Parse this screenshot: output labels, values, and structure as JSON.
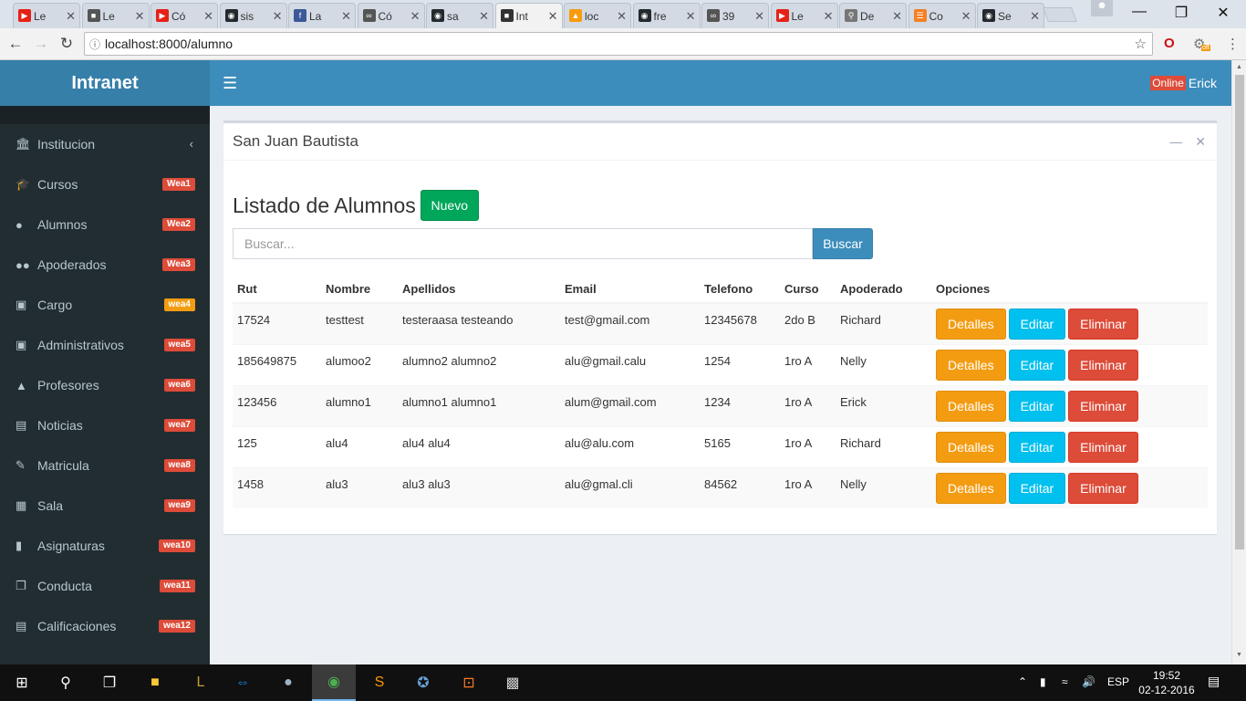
{
  "browser": {
    "tabs": [
      {
        "label": "Le",
        "icon": "youtube-icon",
        "color": "#e62117",
        "active": false
      },
      {
        "label": "Le",
        "icon": "puz-icon",
        "color": "#555555",
        "active": false
      },
      {
        "label": "Có",
        "icon": "youtube-icon",
        "color": "#e62117",
        "active": false
      },
      {
        "label": "sis",
        "icon": "github-icon",
        "color": "#24292e",
        "active": false
      },
      {
        "label": "La",
        "icon": "facebook-icon",
        "color": "#3b5998",
        "active": false
      },
      {
        "label": "Có",
        "icon": "infinity-icon",
        "color": "#555555",
        "active": false
      },
      {
        "label": "sa",
        "icon": "github-icon",
        "color": "#24292e",
        "active": false
      },
      {
        "label": "Int",
        "icon": "intranet-icon",
        "color": "#333333",
        "active": true
      },
      {
        "label": "loc",
        "icon": "phpmyadmin-icon",
        "color": "#f89c0e",
        "active": false
      },
      {
        "label": "fre",
        "icon": "github-icon",
        "color": "#24292e",
        "active": false
      },
      {
        "label": "39",
        "icon": "infinity-icon",
        "color": "#555555",
        "active": false
      },
      {
        "label": "Le",
        "icon": "youtube-icon",
        "color": "#e62117",
        "active": false
      },
      {
        "label": "De",
        "icon": "search-icon",
        "color": "#777777",
        "active": false
      },
      {
        "label": "Co",
        "icon": "stackoverflow-icon",
        "color": "#f48024",
        "active": false
      },
      {
        "label": "Se",
        "icon": "github-icon",
        "color": "#24292e",
        "active": false
      }
    ],
    "url": "localhost:8000/alumno",
    "extension_badge": "off"
  },
  "app": {
    "brand": "Intranet",
    "user": {
      "status": "Online",
      "name": "Erick"
    },
    "sidebar": {
      "items": [
        {
          "label": "Institucion",
          "icon": "bank-icon",
          "badge": "",
          "badge_color": ""
        },
        {
          "label": "Cursos",
          "icon": "graduation-cap-icon",
          "badge": "Wea1",
          "badge_color": "#dd4b39"
        },
        {
          "label": "Alumnos",
          "icon": "user-icon",
          "badge": "Wea2",
          "badge_color": "#dd4b39"
        },
        {
          "label": "Apoderados",
          "icon": "users-icon",
          "badge": "Wea3",
          "badge_color": "#dd4b39"
        },
        {
          "label": "Cargo",
          "icon": "briefcase-icon",
          "badge": "wea4",
          "badge_color": "#f39c12"
        },
        {
          "label": "Administrativos",
          "icon": "lock-icon",
          "badge": "wea5",
          "badge_color": "#dd4b39"
        },
        {
          "label": "Profesores",
          "icon": "male-icon",
          "badge": "wea6",
          "badge_color": "#dd4b39"
        },
        {
          "label": "Noticias",
          "icon": "newspaper-icon",
          "badge": "wea7",
          "badge_color": "#dd4b39"
        },
        {
          "label": "Matricula",
          "icon": "edit-icon",
          "badge": "wea8",
          "badge_color": "#dd4b39"
        },
        {
          "label": "Sala",
          "icon": "building-icon",
          "badge": "wea9",
          "badge_color": "#dd4b39"
        },
        {
          "label": "Asignaturas",
          "icon": "book-icon",
          "badge": "wea10",
          "badge_color": "#dd4b39"
        },
        {
          "label": "Conducta",
          "icon": "copy-icon",
          "badge": "wea11",
          "badge_color": "#dd4b39"
        },
        {
          "label": "Calificaciones",
          "icon": "file-icon",
          "badge": "wea12",
          "badge_color": "#dd4b39"
        }
      ]
    },
    "box": {
      "title": "San Juan Bautista",
      "list_title": "Listado de Alumnos",
      "new_button": "Nuevo",
      "search_placeholder": "Buscar...",
      "search_button": "Buscar",
      "table": {
        "headers": [
          "Rut",
          "Nombre",
          "Apellidos",
          "Email",
          "Telefono",
          "Curso",
          "Apoderado",
          "Opciones"
        ],
        "rows": [
          {
            "rut": "17524",
            "nombre": "testtest",
            "apellidos": "testeraasa testeando",
            "email": "test@gmail.com",
            "telefono": "12345678",
            "curso": "2do B",
            "apoderado": "Richard"
          },
          {
            "rut": "185649875",
            "nombre": "alumoo2",
            "apellidos": "alumno2 alumno2",
            "email": "alu@gmail.calu",
            "telefono": "1254",
            "curso": "1ro A",
            "apoderado": "Nelly"
          },
          {
            "rut": "123456",
            "nombre": "alumno1",
            "apellidos": "alumno1 alumno1",
            "email": "alum@gmail.com",
            "telefono": "1234",
            "curso": "1ro A",
            "apoderado": "Erick"
          },
          {
            "rut": "125",
            "nombre": "alu4",
            "apellidos": "alu4 alu4",
            "email": "alu@alu.com",
            "telefono": "5165",
            "curso": "1ro A",
            "apoderado": "Richard"
          },
          {
            "rut": "1458",
            "nombre": "alu3",
            "apellidos": "alu3 alu3",
            "email": "alu@gmal.cli",
            "telefono": "84562",
            "curso": "1ro A",
            "apoderado": "Nelly"
          }
        ],
        "actions": {
          "details": "Detalles",
          "edit": "Editar",
          "delete": "Eliminar"
        }
      }
    }
  },
  "taskbar": {
    "language": "ESP",
    "time": "19:52",
    "date": "02-12-2016"
  }
}
